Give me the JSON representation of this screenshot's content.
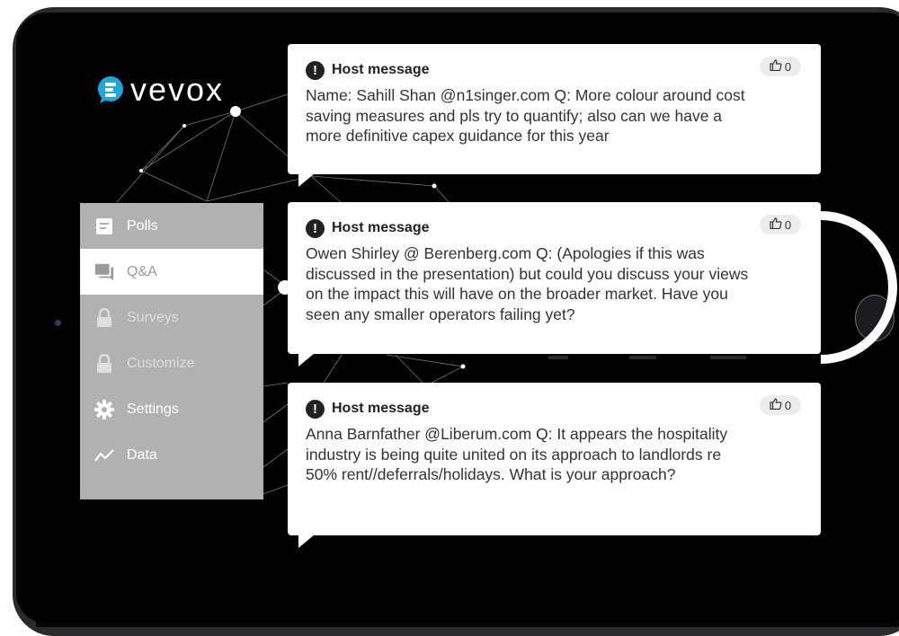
{
  "app": {
    "brand": "vevox",
    "colors": {
      "accent": "#1ba8e0",
      "menu_bg": "#b1b1b1",
      "screen_bg": "#000000"
    }
  },
  "menu": {
    "items": [
      {
        "label": "Polls",
        "icon": "poll-icon",
        "state": "normal"
      },
      {
        "label": "Q&A",
        "icon": "chat-icon",
        "state": "active"
      },
      {
        "label": "Surveys",
        "icon": "lock-icon",
        "state": "locked"
      },
      {
        "label": "Customize",
        "icon": "lock-icon",
        "state": "locked"
      },
      {
        "label": "Settings",
        "icon": "gear-icon",
        "state": "normal"
      },
      {
        "label": "Data",
        "icon": "trend-icon",
        "state": "normal"
      }
    ]
  },
  "messages": [
    {
      "title": "Host message",
      "likes": "0",
      "text": "Name: Sahill Shan @n1singer.com Q: More colour around cost saving measures and pls try to quantify; also can we have a more definitive capex guidance for this year"
    },
    {
      "title": "Host message",
      "likes": "0",
      "text": "Owen Shirley @ Berenberg.com Q: (Apologies if this was discussed in the presentation) but could you discuss your views on the impact this will have on the broader market. Have you seen any smaller operators failing yet?"
    },
    {
      "title": "Host message",
      "likes": "0",
      "text": "Anna Barnfather @Liberum.com Q: It appears the hospitality industry is being quite united on its approach to landlords re 50% rent//deferrals/holidays. What is your approach?"
    }
  ]
}
